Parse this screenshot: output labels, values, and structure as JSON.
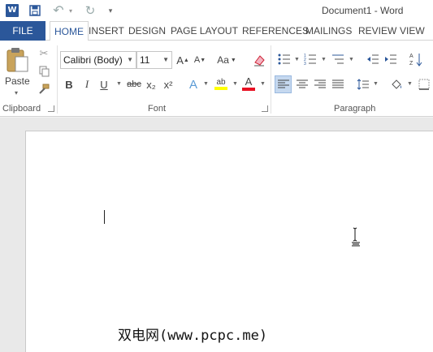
{
  "window": {
    "title": "Document1 - Word",
    "app_icon_letter": "W"
  },
  "quick_access": [
    "save-icon",
    "undo-icon",
    "redo-icon",
    "customize-icon"
  ],
  "tabs": [
    {
      "label": "FILE"
    },
    {
      "label": "HOME",
      "active": true
    },
    {
      "label": "INSERT"
    },
    {
      "label": "DESIGN"
    },
    {
      "label": "PAGE LAYOUT"
    },
    {
      "label": "REFERENCES"
    },
    {
      "label": "MAILINGS"
    },
    {
      "label": "REVIEW"
    },
    {
      "label": "VIEW"
    }
  ],
  "ribbon": {
    "clipboard": {
      "label": "Clipboard",
      "paste_label": "Paste"
    },
    "font": {
      "label": "Font",
      "font_name": "Calibri (Body)",
      "font_size": "11",
      "change_case": "Aa",
      "bold": "B",
      "italic": "I",
      "underline": "U",
      "strikethrough": "abc",
      "subscript": "x₂",
      "superscript": "x²",
      "text_effects": "A",
      "highlight": "ab",
      "font_color": "A",
      "highlight_color": "#ffff00",
      "font_color_value": "#e81123"
    },
    "paragraph": {
      "label": "Paragraph",
      "active_alignment": "left"
    }
  },
  "colors": {
    "accent": "#2b579a"
  },
  "watermark": "双电网(www.pcpc.me)"
}
